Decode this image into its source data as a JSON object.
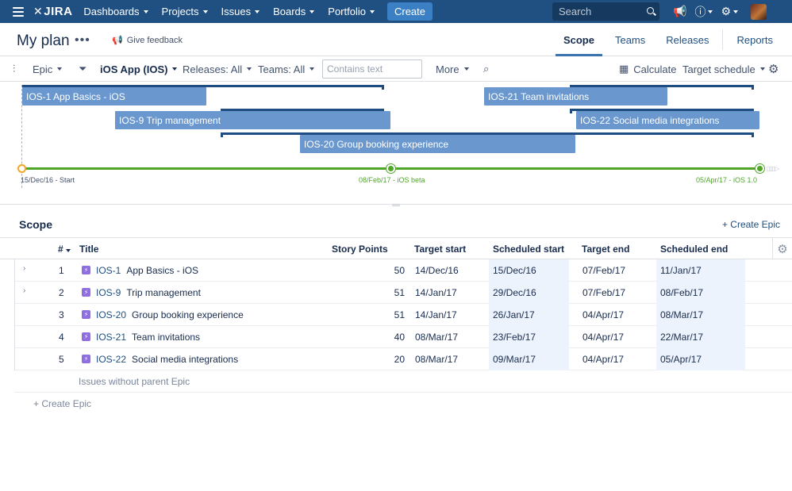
{
  "nav": {
    "logo": "JIRA",
    "items": [
      "Dashboards",
      "Projects",
      "Issues",
      "Boards",
      "Portfolio"
    ],
    "create": "Create",
    "search_placeholder": "Search"
  },
  "plan": {
    "title": "My plan",
    "more": "•••",
    "feedback": "Give feedback",
    "tabs": [
      "Scope",
      "Teams",
      "Releases",
      "Reports"
    ]
  },
  "toolbar": {
    "hierarchy": "Epic",
    "project": "iOS App (IOS)",
    "releases": "Releases: All",
    "teams": "Teams: All",
    "filter_placeholder": "Contains text",
    "more": "More",
    "calculate": "Calculate",
    "schedule": "Target schedule"
  },
  "timeline": {
    "bars": [
      {
        "label": "IOS-1 App Basics - iOS"
      },
      {
        "label": "IOS-9 Trip management"
      },
      {
        "label": "IOS-20 Group booking experience"
      },
      {
        "label": "IOS-21 Team invitations"
      },
      {
        "label": "IOS-22 Social media integrations"
      }
    ],
    "milestones": [
      {
        "label": "15/Dec/16 - Start",
        "color": "#f5a623"
      },
      {
        "label": "08/Feb/17 - iOS beta",
        "color": "#4fa629"
      },
      {
        "label": "05/Apr/17 - iOS 1.0",
        "color": "#4fa629"
      }
    ]
  },
  "scope": {
    "title": "Scope",
    "create_epic": "+ Create Epic",
    "columns": {
      "num": "#",
      "title": "Title",
      "story_points": "Story Points",
      "target_start": "Target start",
      "scheduled_start": "Scheduled start",
      "target_end": "Target end",
      "scheduled_end": "Scheduled end"
    },
    "rows": [
      {
        "num": "1",
        "key": "IOS-1",
        "title": "App Basics - iOS",
        "points": "50",
        "target_start": "14/Dec/16",
        "scheduled_start": "15/Dec/16",
        "target_end": "07/Feb/17",
        "scheduled_end": "11/Jan/17"
      },
      {
        "num": "2",
        "key": "IOS-9",
        "title": "Trip management",
        "points": "51",
        "target_start": "14/Jan/17",
        "scheduled_start": "29/Dec/16",
        "target_end": "07/Feb/17",
        "scheduled_end": "08/Feb/17"
      },
      {
        "num": "3",
        "key": "IOS-20",
        "title": "Group booking experience",
        "points": "51",
        "target_start": "14/Jan/17",
        "scheduled_start": "26/Jan/17",
        "target_end": "04/Apr/17",
        "scheduled_end": "08/Mar/17"
      },
      {
        "num": "4",
        "key": "IOS-21",
        "title": "Team invitations",
        "points": "40",
        "target_start": "08/Mar/17",
        "scheduled_start": "23/Feb/17",
        "target_end": "04/Apr/17",
        "scheduled_end": "22/Mar/17"
      },
      {
        "num": "5",
        "key": "IOS-22",
        "title": "Social media integrations",
        "points": "20",
        "target_start": "08/Mar/17",
        "scheduled_start": "09/Mar/17",
        "target_end": "04/Apr/17",
        "scheduled_end": "05/Apr/17"
      }
    ],
    "no_parent": "Issues without parent Epic",
    "create_epic_bottom": "+ Create Epic"
  }
}
